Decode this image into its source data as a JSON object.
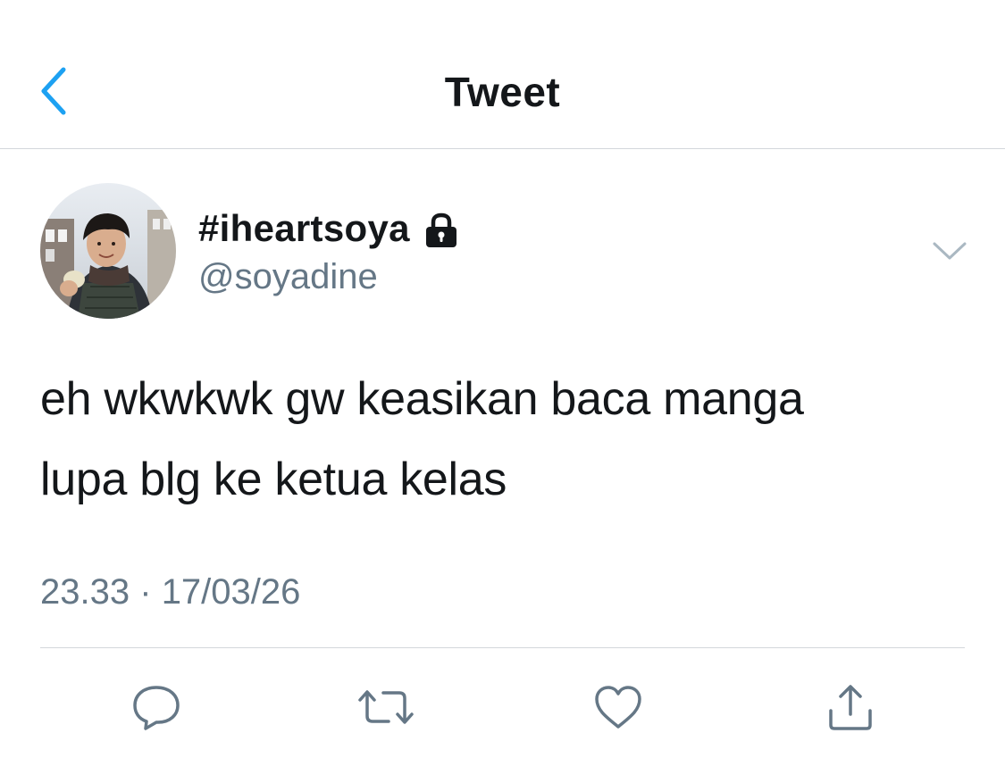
{
  "header": {
    "title": "Tweet"
  },
  "tweet": {
    "display_name": "#iheartsoya",
    "handle": "@soyadine",
    "text_lines": [
      "eh wkwkwk gw keasikan baca manga",
      "lupa blg ke ketua kelas"
    ],
    "time": "23.33",
    "separator": "·",
    "date": "17/03/26",
    "protected": true
  },
  "icons": {
    "back": "chevron-left-icon",
    "lock": "lock-icon",
    "more": "chevron-down-icon",
    "reply": "reply-icon",
    "retweet": "retweet-icon",
    "like": "heart-icon",
    "share": "share-icon"
  },
  "colors": {
    "accent": "#1da1f2",
    "text": "#14171a",
    "secondary": "#657786",
    "divider": "#d3d7db"
  }
}
